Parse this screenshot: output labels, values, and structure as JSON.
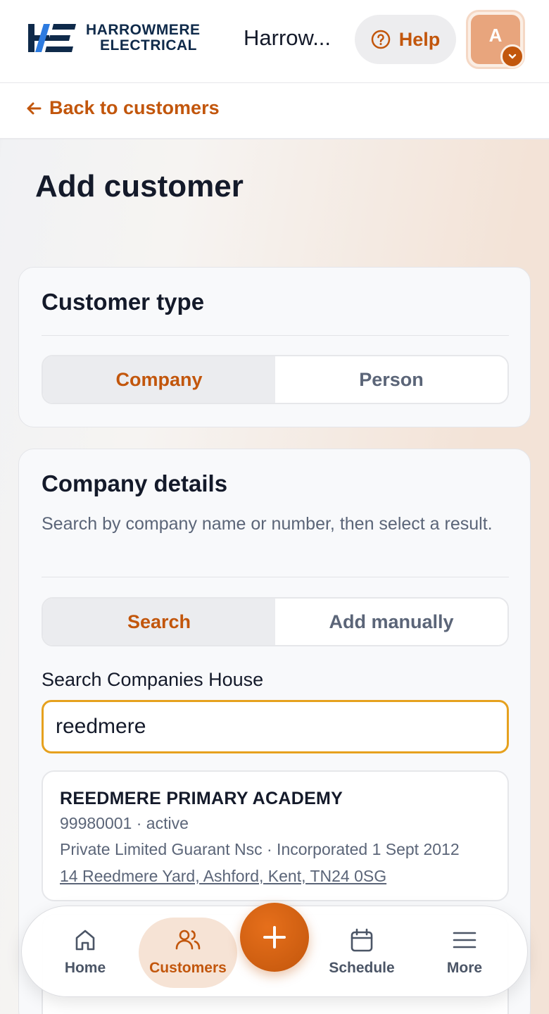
{
  "header": {
    "logo_line1": "HARROWMERE",
    "logo_line2": "ELECTRICAL",
    "app_title": "Harrow...",
    "help_label": "Help",
    "avatar_initial": "A"
  },
  "subbar": {
    "back_label": "Back to customers"
  },
  "page": {
    "title": "Add customer"
  },
  "customer_type": {
    "heading": "Customer type",
    "options": [
      "Company",
      "Person"
    ],
    "selected": "Company"
  },
  "company_details": {
    "heading": "Company details",
    "description": "Search by company name or number, then select a result.",
    "modes": [
      "Search",
      "Add manually"
    ],
    "selected_mode": "Search",
    "search_label": "Search Companies House",
    "search_value": "reedmere",
    "results": [
      {
        "name": "REEDMERE PRIMARY ACADEMY",
        "number_status": "99980001 · active",
        "type_incorporated": "Private Limited Guarant Nsc · Incorporated 1 Sept 2012",
        "address": "14 Reedmere Yard, Ashford, Kent, TN24 0SG"
      }
    ]
  },
  "bottom_nav": {
    "items": [
      "Home",
      "Customers",
      "Schedule",
      "More"
    ],
    "active": "Customers"
  },
  "colors": {
    "accent": "#c2560c",
    "focus_border": "#e6a11e",
    "text": "#141a2a",
    "muted": "#5b6578"
  }
}
